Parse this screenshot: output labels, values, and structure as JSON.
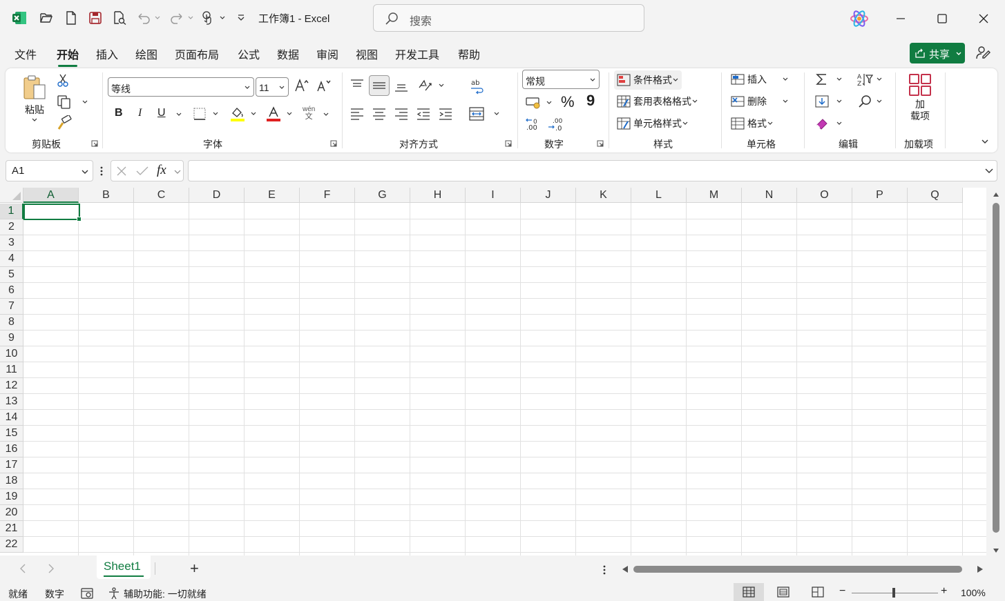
{
  "app": {
    "document_title": "工作簿1  -  Excel",
    "search_placeholder": "搜索"
  },
  "tabs": [
    "文件",
    "开始",
    "插入",
    "绘图",
    "页面布局",
    "公式",
    "数据",
    "审阅",
    "视图",
    "开发工具",
    "帮助"
  ],
  "active_tab": "开始",
  "share_label": "共享",
  "ribbon": {
    "clipboard": {
      "paste": "粘贴",
      "group": "剪贴板"
    },
    "font": {
      "family": "等线",
      "size": "11",
      "bold": "B",
      "italic": "I",
      "underline": "U",
      "group": "字体",
      "phonetic_top": "wén",
      "phonetic_bottom": "文"
    },
    "alignment": {
      "group": "对齐方式"
    },
    "number": {
      "format": "常规",
      "percent": "%",
      "comma": "9",
      "dec_inc": "←.0 .00",
      "dec_dec": ".00 →.0",
      "group": "数字"
    },
    "styles": {
      "conditional": "条件格式",
      "table": "套用表格格式",
      "cell": "单元格样式",
      "group": "样式"
    },
    "cells": {
      "insert": "插入",
      "delete": "删除",
      "format": "格式",
      "group": "单元格"
    },
    "editing": {
      "group": "编辑"
    },
    "addins": {
      "label_line1": "加",
      "label_line2": "载项",
      "group": "加载项"
    }
  },
  "formula_bar": {
    "name_box": "A1",
    "fx": "fx",
    "formula": ""
  },
  "grid": {
    "columns": [
      "A",
      "B",
      "C",
      "D",
      "E",
      "F",
      "G",
      "H",
      "I",
      "J",
      "K",
      "L",
      "M",
      "N",
      "O",
      "P",
      "Q"
    ],
    "rows": [
      "1",
      "2",
      "3",
      "4",
      "5",
      "6",
      "7",
      "8",
      "9",
      "10",
      "11",
      "12",
      "13",
      "14",
      "15",
      "16",
      "17",
      "18",
      "19",
      "20",
      "21",
      "22"
    ],
    "active_cell": "A1"
  },
  "sheets": {
    "tabs": [
      "Sheet1"
    ],
    "add": "+"
  },
  "status": {
    "ready": "就绪",
    "mode": "数字",
    "accessibility": "辅助功能: 一切就绪",
    "zoom": "100%",
    "zoom_minus": "−",
    "zoom_plus": "+"
  },
  "colors": {
    "accent": "#107c41",
    "background": "#f3f3f3"
  }
}
